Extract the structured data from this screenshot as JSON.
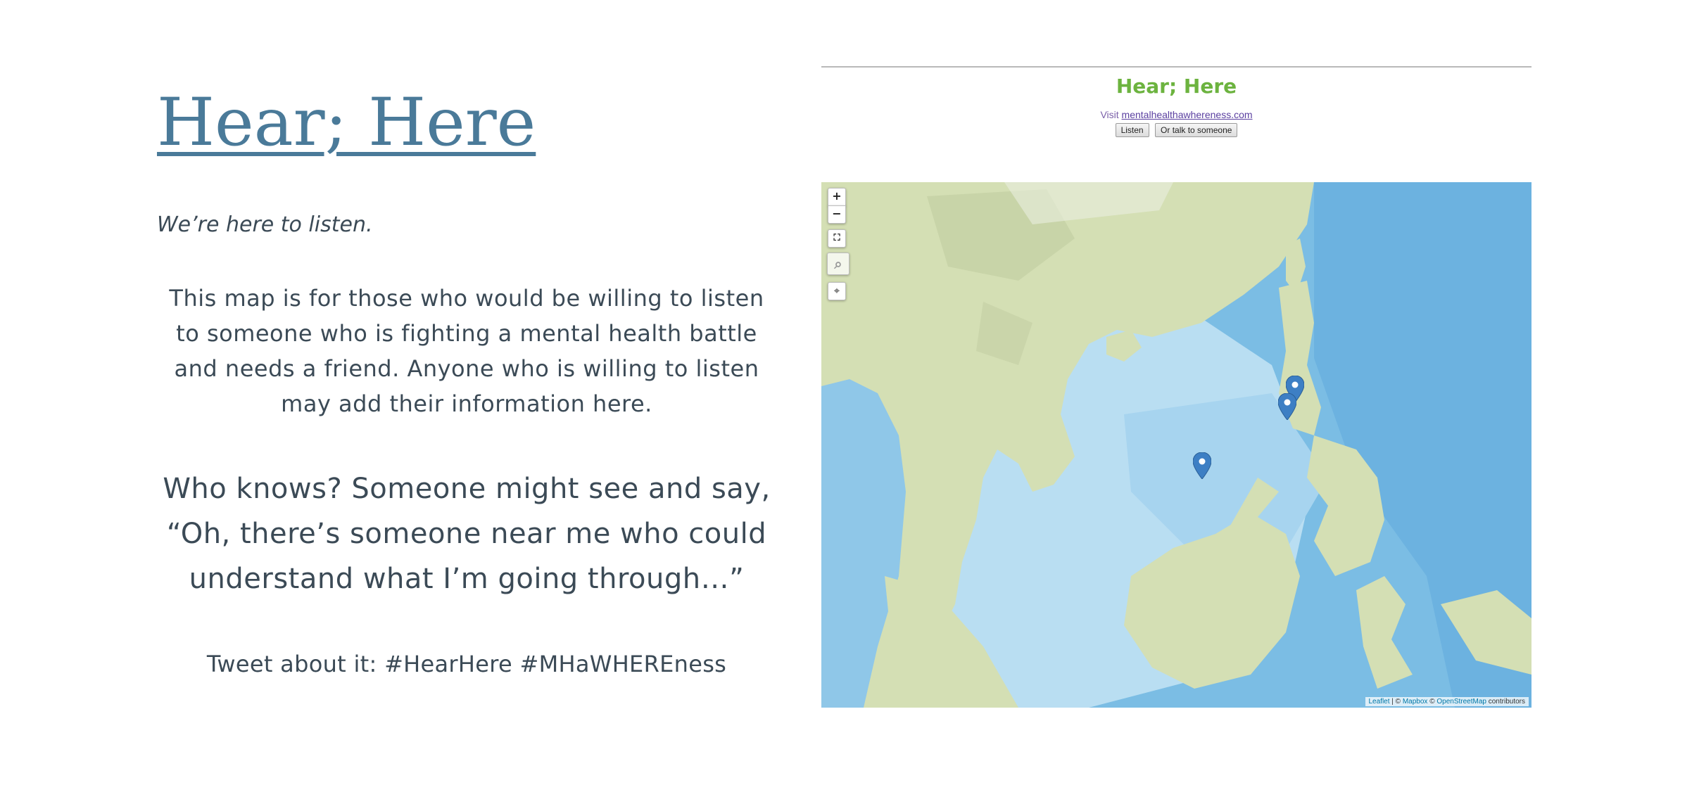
{
  "site": {
    "title": "Hear; Here",
    "tagline": "We’re here to listen.",
    "paragraph": "This map is for those who would be willing to listen to someone who is fighting a mental health battle and needs a friend. Anyone who is willing to listen may add their information here.",
    "quote": "Who knows? Someone might see and say, “Oh, there’s someone near me who could understand what I’m going through…”",
    "tweet": "Tweet about it: #HearHere #MHaWHEREness"
  },
  "embed": {
    "title": "Hear; Here",
    "visit_prefix": "Visit ",
    "visit_link": "mentalhealthawhereness.com",
    "listen_button": "Listen",
    "talk_button": "Or talk to someone"
  },
  "map": {
    "zoom_in": "+",
    "zoom_out": "−",
    "attribution": {
      "leaflet": "Leaflet",
      "sep1": " | © ",
      "mapbox": "Mapbox",
      "sep2": " © ",
      "osm": "OpenStreetMap",
      "suffix": " contributors"
    },
    "colors": {
      "ocean": "#7bbde4",
      "shallow": "#b9def2",
      "land": "#d4dfb4",
      "marker": "#3d7fc4"
    },
    "icons": [
      "fullscreen-icon",
      "search-icon",
      "locate-icon",
      "map-marker-icon"
    ]
  }
}
